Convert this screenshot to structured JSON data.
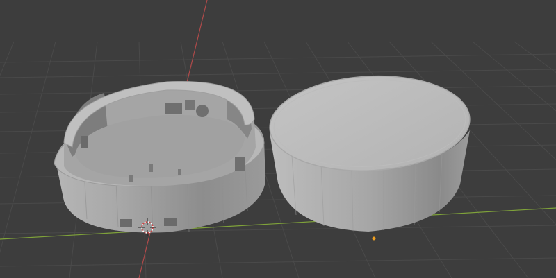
{
  "viewport": {
    "background": "#3d3d3d",
    "grid_color": "#4a4a4a",
    "x_axis_color": "#7fa23a",
    "y_axis_color": "#b04a4a",
    "origin_color": "#f0a020"
  },
  "objects": [
    {
      "name": "enclosure-base",
      "shape": "cylinder-shell",
      "color": "#a9a9a9"
    },
    {
      "name": "enclosure-lid",
      "shape": "cylinder-cap",
      "color": "#b3b3b3"
    }
  ],
  "icons": {
    "origin_point": "origin-dot",
    "cursor_3d": "3d-cursor"
  }
}
